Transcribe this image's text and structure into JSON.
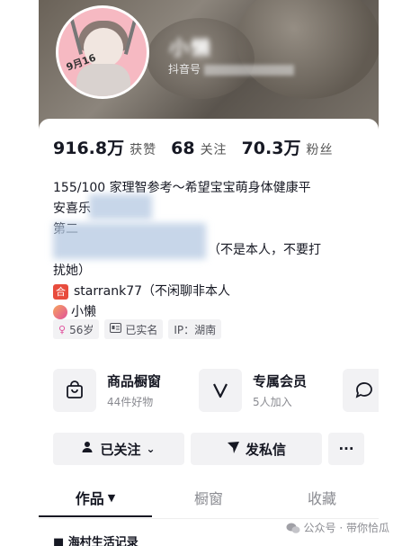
{
  "profile": {
    "nickname": "小懒",
    "douyin_id_label": "抖音号",
    "avatar_text": "9月16"
  },
  "stats": [
    {
      "value": "916.8万",
      "label": "获赞"
    },
    {
      "value": "68",
      "label": "关注"
    },
    {
      "value": "70.3万",
      "label": "粉丝"
    }
  ],
  "bio": {
    "line1": "155/100 家理智参考～希望宝宝萌身体健康平",
    "line2": "安喜乐",
    "line3": "第二",
    "line4": "（不是本人，不要打",
    "line5": "扰她）",
    "line6_tag": "合",
    "line6": "starrank77（不闲聊非本人",
    "line7": "小懒"
  },
  "chips": [
    {
      "icon": "female-icon",
      "label": "56岁"
    },
    {
      "icon": "id-card-icon",
      "label": "已实名"
    },
    {
      "icon": "location",
      "label": "IP：湖南"
    }
  ],
  "services": [
    {
      "title": "商品橱窗",
      "sub": "44件好物"
    },
    {
      "title": "专属会员",
      "sub": "5人加入"
    }
  ],
  "buttons": {
    "followed": "已关注",
    "message": "发私信",
    "more": "···"
  },
  "tabs": [
    {
      "label": "作品"
    },
    {
      "label": "橱窗"
    },
    {
      "label": "收藏"
    }
  ],
  "below_text": "■ 海村生活记录",
  "watermark": "公众号 · 带你恰瓜"
}
